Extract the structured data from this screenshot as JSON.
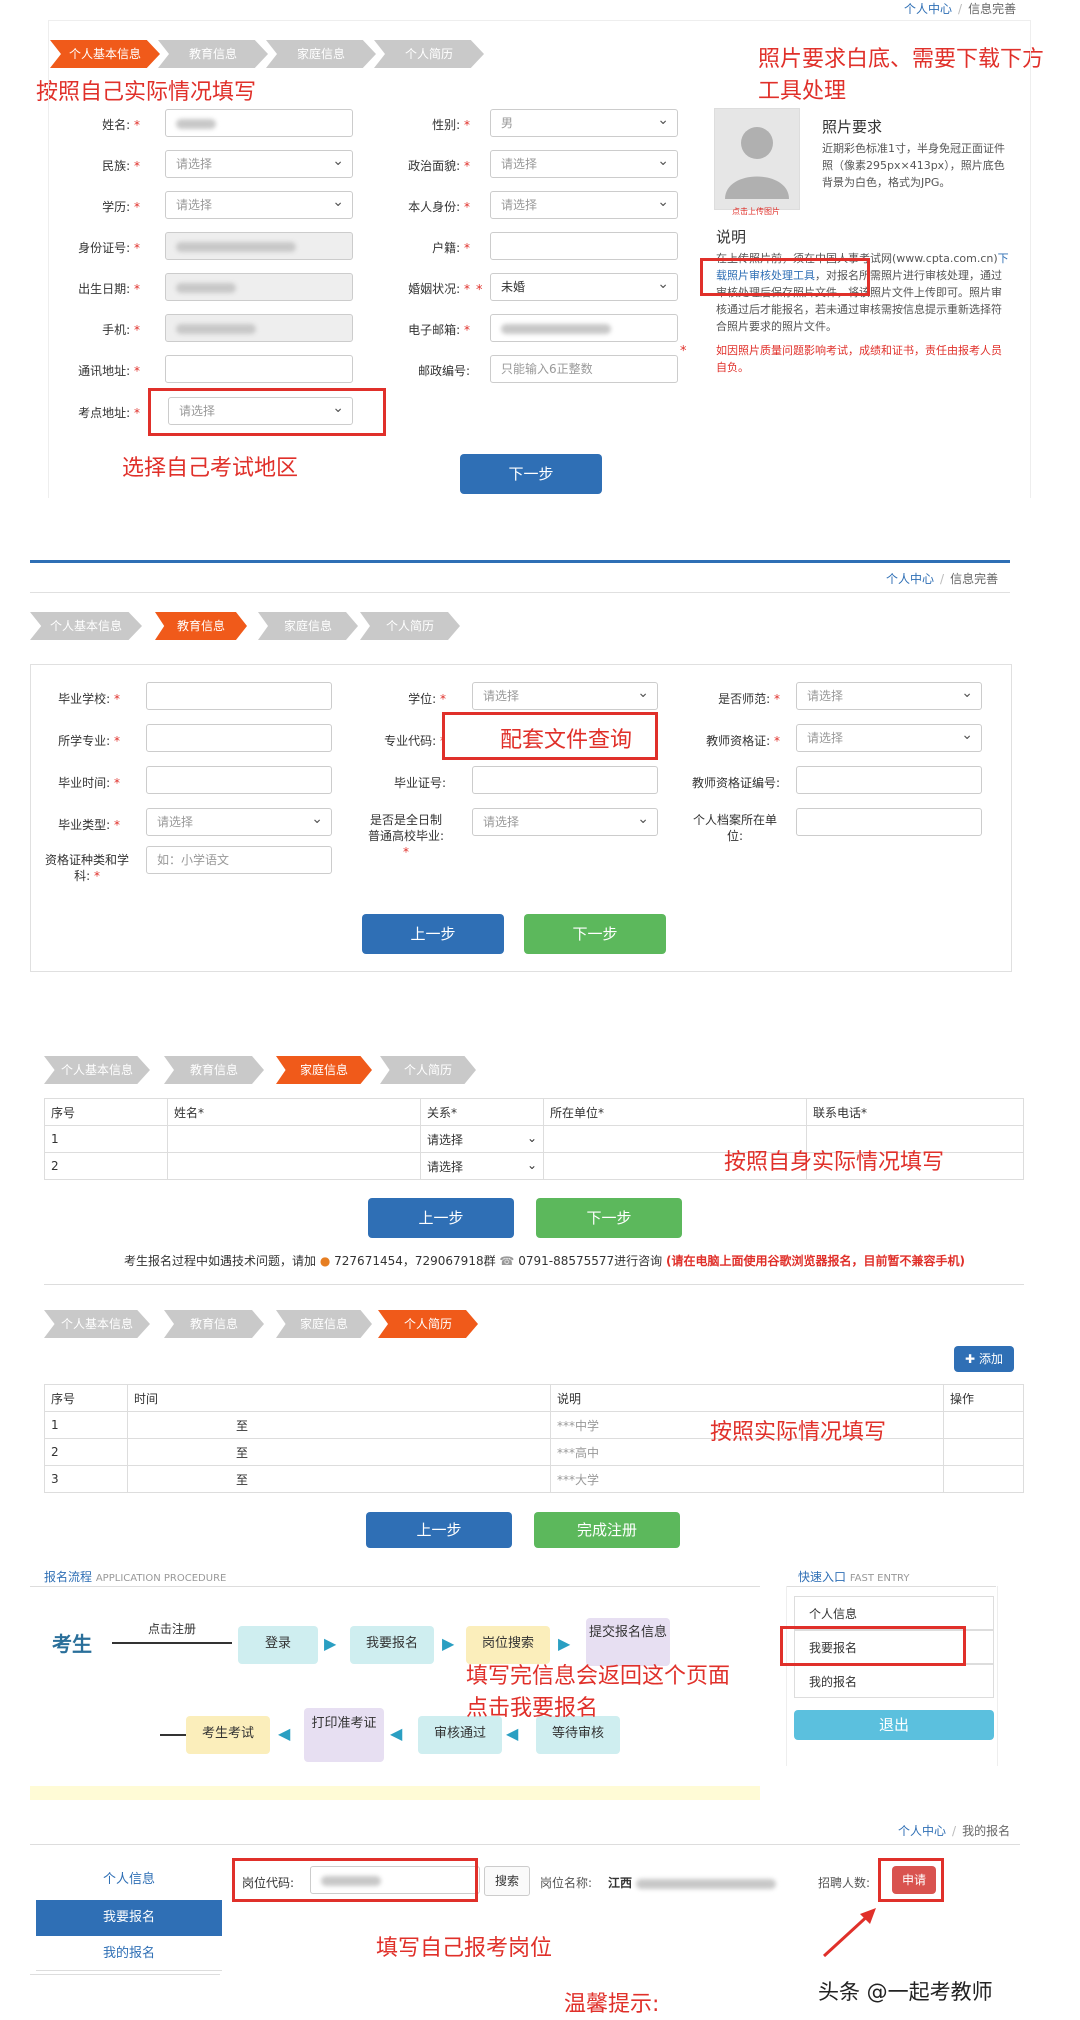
{
  "s1": {
    "crumb": [
      "个人中心",
      "信息完善"
    ],
    "steps": [
      "个人基本信息",
      "教育信息",
      "家庭信息",
      "个人简历"
    ],
    "annot_left": "按照自己实际情况填写",
    "annot_right": "照片要求白底、需要下载下方\n工具处理",
    "annot_exam": "选择自己考试地区",
    "labels": {
      "name": "姓名:",
      "gender": "性别:",
      "ethnic": "民族:",
      "political": "政治面貌:",
      "education": "学历:",
      "identity": "本人身份:",
      "idcard": "身份证号:",
      "hukou": "户籍:",
      "birth": "出生日期:",
      "marital": "婚姻状况:",
      "phone": "手机:",
      "email": "电子邮箱:",
      "address": "通讯地址:",
      "postcode": "邮政编号:",
      "exam_site": "考点地址:"
    },
    "values": {
      "gender": "男",
      "ethnic": "请选择",
      "political": "请选择",
      "education": "请选择",
      "identity": "请选择",
      "marital": "未婚",
      "postcode_placeholder": "只能输入6正整数",
      "exam_site": "请选择"
    },
    "photo_title": "照片要求",
    "photo_text": "近期彩色标准1寸，半身免冠正面证件照（像素295px×413px），照片底色背景为白色，格式为JPG。",
    "photo_caption": "点击上传图片",
    "note_title": "说明",
    "note_text1": "在上传照片前，须在中国人事考试网(www.cpta.com.cn)",
    "note_link": "下载照片审核处理工具",
    "note_text2": "，对报名所需照片进行审核处理，通过审核处理后保存照片文件，将该照片文件上传即可。照片审核通过后才能报名，若未通过审核需按信息提示重新选择符合照片要求的照片文件。",
    "note_warn": "如因照片质量问题影响考试，成绩和证书，责任由报考人员自负。",
    "next": "下一步"
  },
  "s2": {
    "crumb": [
      "个人中心",
      "信息完善"
    ],
    "steps": [
      "个人基本信息",
      "教育信息",
      "家庭信息",
      "个人简历"
    ],
    "annot": "配套文件查询",
    "labels": {
      "school": "毕业学校:",
      "degree": "学位:",
      "normal": "是否师范:",
      "major": "所学专业:",
      "major_code": "专业代码:",
      "teacher_cert": "教师资格证:",
      "grad_time": "毕业时间:",
      "grad_no": "毕业证号:",
      "teacher_cert_no": "教师资格证编号:",
      "grad_type": "毕业类型:",
      "fulltime": "是否是全日制普通高校毕业:",
      "archive": "个人档案所在单位:",
      "cert_subject": "资格证种类和学科:"
    },
    "values": {
      "degree": "请选择",
      "normal": "请选择",
      "teacher_cert": "请选择",
      "grad_type": "请选择",
      "fulltime": "请选择",
      "cert_placeholder": "如：小学语文"
    },
    "prev": "上一步",
    "next": "下一步"
  },
  "s3": {
    "steps": [
      "个人基本信息",
      "教育信息",
      "家庭信息",
      "个人简历"
    ],
    "headers": [
      "序号",
      "姓名*",
      "关系*",
      "所在单位*",
      "联系电话*"
    ],
    "rows": [
      [
        "1",
        "",
        "请选择",
        "",
        ""
      ],
      [
        "2",
        "",
        "请选择",
        "",
        ""
      ]
    ],
    "annot": "按照自身实际情况填写",
    "prev": "上一步",
    "next": "下一步",
    "help_a": "考生报名过程中如遇技术问题，请加",
    "help_qq": "727671454，729067918群",
    "help_tel": "0791-88575577进行咨询",
    "help_red": "(请在电脑上面使用谷歌浏览器报名，目前暂不兼容手机)"
  },
  "s4": {
    "steps": [
      "个人基本信息",
      "教育信息",
      "家庭信息",
      "个人简历"
    ],
    "add": "添加",
    "headers": [
      "序号",
      "时间",
      "说明",
      "操作"
    ],
    "rows": [
      [
        "1",
        "至",
        "***中学"
      ],
      [
        "2",
        "至",
        "***高中"
      ],
      [
        "3",
        "至",
        "***大学"
      ]
    ],
    "annot": "按照实际情况填写",
    "prev": "上一步",
    "finish": "完成注册"
  },
  "s5": {
    "title": "报名流程",
    "title_en": "APPLICATION PROCEDURE",
    "candidate": "考生",
    "click_register": "点击注册",
    "flow": [
      "登录",
      "我要报名",
      "岗位搜索",
      "提交报名信息",
      "等待审核",
      "审核通过",
      "打印准考证",
      "考生考试"
    ],
    "annot1": "填写完信息会返回这个页面",
    "annot2": "点击我要报名",
    "quick_title": "快速入口",
    "quick_en": "FAST ENTRY",
    "quick_items": [
      "个人信息",
      "我要报名",
      "我的报名"
    ],
    "logout": "退出"
  },
  "s6": {
    "crumb": [
      "个人中心",
      "我的报名"
    ],
    "side": [
      "个人信息",
      "我要报名",
      "我的报名"
    ],
    "post_code": "岗位代码:",
    "search": "搜索",
    "post_name": "岗位名称:",
    "post_name_val": "江西",
    "recruit": "招聘人数:",
    "apply": "申请",
    "annot": "填写自己报考岗位",
    "tip": "温馨提示:",
    "credit": "头条 @一起考教师"
  }
}
